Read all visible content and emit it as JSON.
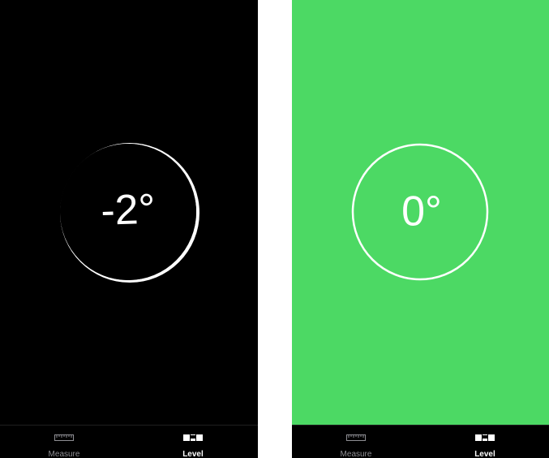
{
  "screens": [
    {
      "id": "left",
      "state": "tilted",
      "background_color": "#000000",
      "angle_text": "-2°",
      "tabs": [
        {
          "label": "Measure",
          "icon": "ruler-icon",
          "selected": false
        },
        {
          "label": "Level",
          "icon": "level-icon",
          "selected": true
        }
      ]
    },
    {
      "id": "right",
      "state": "level",
      "background_color": "#4cd964",
      "angle_text": "0°",
      "tabs": [
        {
          "label": "Measure",
          "icon": "ruler-icon",
          "selected": false
        },
        {
          "label": "Level",
          "icon": "level-icon",
          "selected": true
        }
      ]
    }
  ],
  "colors": {
    "tab_selected": "#ffffff",
    "tab_unselected": "#8e8e93",
    "level_green": "#4cd964"
  }
}
